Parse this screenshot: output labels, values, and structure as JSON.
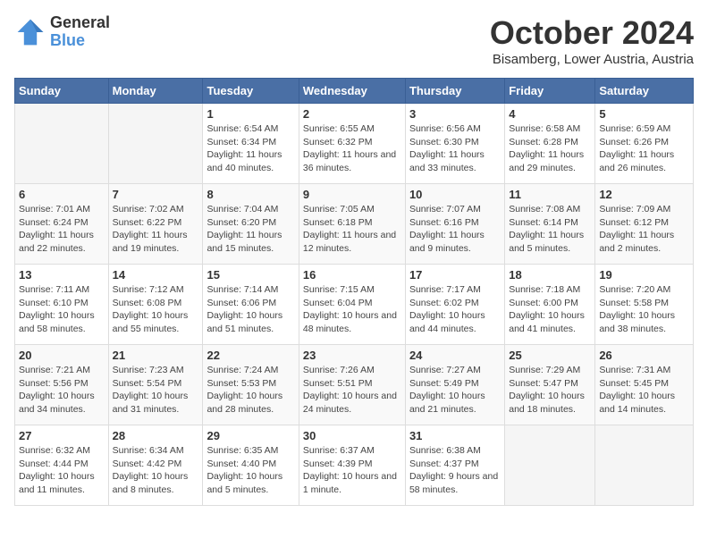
{
  "header": {
    "logo_general": "General",
    "logo_blue": "Blue",
    "month_title": "October 2024",
    "location": "Bisamberg, Lower Austria, Austria"
  },
  "days_of_week": [
    "Sunday",
    "Monday",
    "Tuesday",
    "Wednesday",
    "Thursday",
    "Friday",
    "Saturday"
  ],
  "weeks": [
    [
      {
        "day": "",
        "info": ""
      },
      {
        "day": "",
        "info": ""
      },
      {
        "day": "1",
        "info": "Sunrise: 6:54 AM\nSunset: 6:34 PM\nDaylight: 11 hours and 40 minutes."
      },
      {
        "day": "2",
        "info": "Sunrise: 6:55 AM\nSunset: 6:32 PM\nDaylight: 11 hours and 36 minutes."
      },
      {
        "day": "3",
        "info": "Sunrise: 6:56 AM\nSunset: 6:30 PM\nDaylight: 11 hours and 33 minutes."
      },
      {
        "day": "4",
        "info": "Sunrise: 6:58 AM\nSunset: 6:28 PM\nDaylight: 11 hours and 29 minutes."
      },
      {
        "day": "5",
        "info": "Sunrise: 6:59 AM\nSunset: 6:26 PM\nDaylight: 11 hours and 26 minutes."
      }
    ],
    [
      {
        "day": "6",
        "info": "Sunrise: 7:01 AM\nSunset: 6:24 PM\nDaylight: 11 hours and 22 minutes."
      },
      {
        "day": "7",
        "info": "Sunrise: 7:02 AM\nSunset: 6:22 PM\nDaylight: 11 hours and 19 minutes."
      },
      {
        "day": "8",
        "info": "Sunrise: 7:04 AM\nSunset: 6:20 PM\nDaylight: 11 hours and 15 minutes."
      },
      {
        "day": "9",
        "info": "Sunrise: 7:05 AM\nSunset: 6:18 PM\nDaylight: 11 hours and 12 minutes."
      },
      {
        "day": "10",
        "info": "Sunrise: 7:07 AM\nSunset: 6:16 PM\nDaylight: 11 hours and 9 minutes."
      },
      {
        "day": "11",
        "info": "Sunrise: 7:08 AM\nSunset: 6:14 PM\nDaylight: 11 hours and 5 minutes."
      },
      {
        "day": "12",
        "info": "Sunrise: 7:09 AM\nSunset: 6:12 PM\nDaylight: 11 hours and 2 minutes."
      }
    ],
    [
      {
        "day": "13",
        "info": "Sunrise: 7:11 AM\nSunset: 6:10 PM\nDaylight: 10 hours and 58 minutes."
      },
      {
        "day": "14",
        "info": "Sunrise: 7:12 AM\nSunset: 6:08 PM\nDaylight: 10 hours and 55 minutes."
      },
      {
        "day": "15",
        "info": "Sunrise: 7:14 AM\nSunset: 6:06 PM\nDaylight: 10 hours and 51 minutes."
      },
      {
        "day": "16",
        "info": "Sunrise: 7:15 AM\nSunset: 6:04 PM\nDaylight: 10 hours and 48 minutes."
      },
      {
        "day": "17",
        "info": "Sunrise: 7:17 AM\nSunset: 6:02 PM\nDaylight: 10 hours and 44 minutes."
      },
      {
        "day": "18",
        "info": "Sunrise: 7:18 AM\nSunset: 6:00 PM\nDaylight: 10 hours and 41 minutes."
      },
      {
        "day": "19",
        "info": "Sunrise: 7:20 AM\nSunset: 5:58 PM\nDaylight: 10 hours and 38 minutes."
      }
    ],
    [
      {
        "day": "20",
        "info": "Sunrise: 7:21 AM\nSunset: 5:56 PM\nDaylight: 10 hours and 34 minutes."
      },
      {
        "day": "21",
        "info": "Sunrise: 7:23 AM\nSunset: 5:54 PM\nDaylight: 10 hours and 31 minutes."
      },
      {
        "day": "22",
        "info": "Sunrise: 7:24 AM\nSunset: 5:53 PM\nDaylight: 10 hours and 28 minutes."
      },
      {
        "day": "23",
        "info": "Sunrise: 7:26 AM\nSunset: 5:51 PM\nDaylight: 10 hours and 24 minutes."
      },
      {
        "day": "24",
        "info": "Sunrise: 7:27 AM\nSunset: 5:49 PM\nDaylight: 10 hours and 21 minutes."
      },
      {
        "day": "25",
        "info": "Sunrise: 7:29 AM\nSunset: 5:47 PM\nDaylight: 10 hours and 18 minutes."
      },
      {
        "day": "26",
        "info": "Sunrise: 7:31 AM\nSunset: 5:45 PM\nDaylight: 10 hours and 14 minutes."
      }
    ],
    [
      {
        "day": "27",
        "info": "Sunrise: 6:32 AM\nSunset: 4:44 PM\nDaylight: 10 hours and 11 minutes."
      },
      {
        "day": "28",
        "info": "Sunrise: 6:34 AM\nSunset: 4:42 PM\nDaylight: 10 hours and 8 minutes."
      },
      {
        "day": "29",
        "info": "Sunrise: 6:35 AM\nSunset: 4:40 PM\nDaylight: 10 hours and 5 minutes."
      },
      {
        "day": "30",
        "info": "Sunrise: 6:37 AM\nSunset: 4:39 PM\nDaylight: 10 hours and 1 minute."
      },
      {
        "day": "31",
        "info": "Sunrise: 6:38 AM\nSunset: 4:37 PM\nDaylight: 9 hours and 58 minutes."
      },
      {
        "day": "",
        "info": ""
      },
      {
        "day": "",
        "info": ""
      }
    ]
  ]
}
